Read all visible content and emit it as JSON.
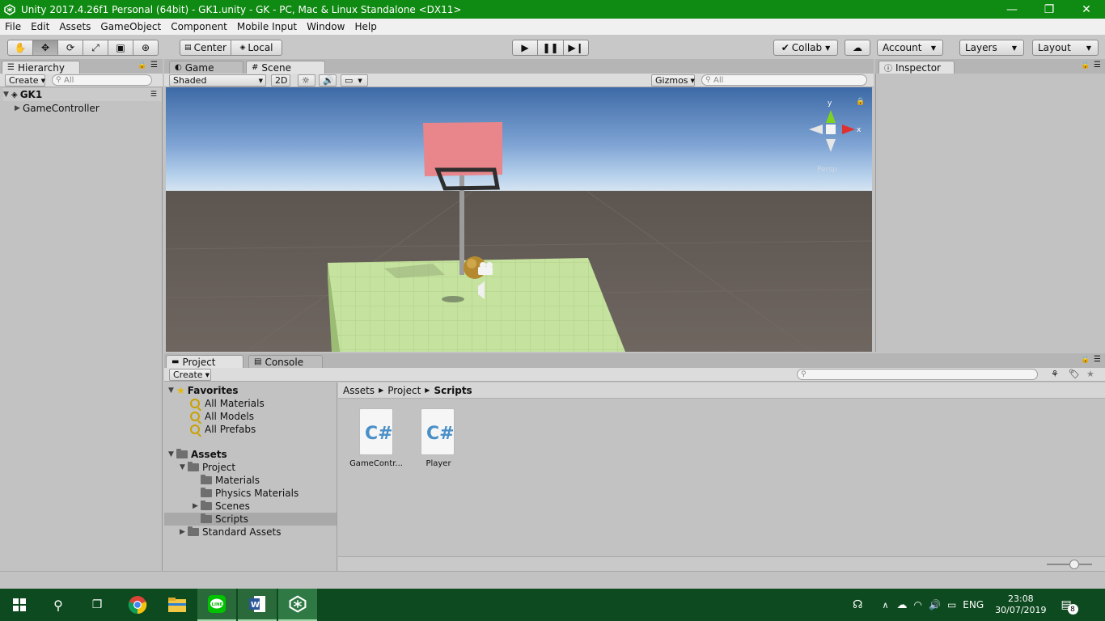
{
  "window": {
    "title": "Unity 2017.4.26f1 Personal (64bit) - GK1.unity - GK - PC, Mac & Linux Standalone <DX11>",
    "controls": [
      "—",
      "❐",
      "✕"
    ]
  },
  "menu": [
    "File",
    "Edit",
    "Assets",
    "GameObject",
    "Component",
    "Mobile Input",
    "Window",
    "Help"
  ],
  "toolbar": {
    "tools": [
      "hand-icon",
      "move-icon",
      "rotate-icon",
      "scale-icon",
      "rect-icon",
      "transform-icon"
    ],
    "center_label": "Center",
    "local_label": "Local",
    "collab_label": "Collab",
    "account_label": "Account",
    "layers_label": "Layers",
    "layout_label": "Layout"
  },
  "hierarchy": {
    "tab_label": "Hierarchy",
    "create_label": "Create",
    "search_placeholder": "All",
    "scene_name": "GK1",
    "items": [
      "GameController"
    ]
  },
  "scene_view": {
    "tabs": [
      "Game",
      "Scene"
    ],
    "shading_label": "Shaded",
    "mode_2d_label": "2D",
    "gizmos_label": "Gizmos",
    "search_placeholder": "All",
    "gizmo_axes": [
      "y",
      "x"
    ],
    "persp_label": "Persp"
  },
  "inspector": {
    "tab_label": "Inspector"
  },
  "project": {
    "tabs": [
      "Project",
      "Console"
    ],
    "create_label": "Create",
    "favorites_label": "Favorites",
    "favorites": [
      "All Materials",
      "All Models",
      "All Prefabs"
    ],
    "assets_label": "Assets",
    "tree": [
      {
        "label": "Project",
        "indent": 1,
        "expanded": true
      },
      {
        "label": "Materials",
        "indent": 2
      },
      {
        "label": "Physics Materials",
        "indent": 2
      },
      {
        "label": "Scenes",
        "indent": 2,
        "collapsed": true
      },
      {
        "label": "Scripts",
        "indent": 2,
        "selected": true
      },
      {
        "label": "Standard Assets",
        "indent": 1,
        "collapsed": true
      }
    ],
    "breadcrumb": [
      "Assets",
      "Project",
      "Scripts"
    ],
    "files": [
      {
        "name": "GameContr...",
        "type": "C#"
      },
      {
        "name": "Player",
        "type": "C#"
      }
    ]
  },
  "taskbar": {
    "apps": [
      "windows-start-icon",
      "search-icon",
      "task-view-icon",
      "chrome-icon",
      "file-explorer-icon",
      "line-icon",
      "word-icon",
      "unity-icon"
    ],
    "language": "ENG",
    "time": "23:08",
    "date": "30/07/2019",
    "notification_count": "8"
  },
  "colors": {
    "titlebar": "#0f8a12",
    "taskbar": "#0d4a1f",
    "panel": "#c2c2c2",
    "selection": "#a9a9a9",
    "backboard": "#e8868b",
    "ground": "#c5e39e"
  }
}
